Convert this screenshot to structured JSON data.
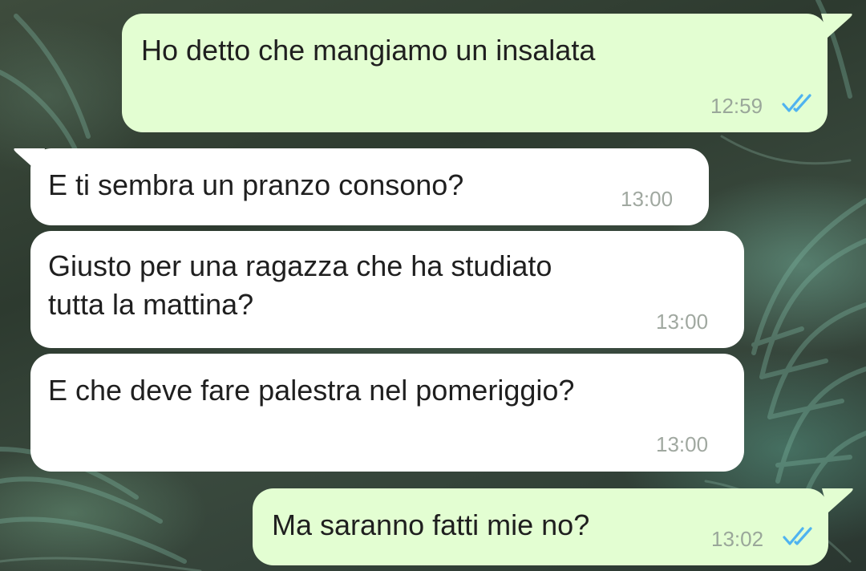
{
  "colors": {
    "outgoing_bubble": "#e3fed2",
    "incoming_bubble": "#ffffff",
    "read_ticks": "#4fb3f0",
    "timestamp": "#a0a8a0"
  },
  "messages": [
    {
      "direction": "outgoing",
      "text": "Ho detto che mangiamo un insalata",
      "time": "12:59",
      "status_icon": "double-check-read-icon"
    },
    {
      "direction": "incoming",
      "text": "E ti sembra un pranzo consono?",
      "time": "13:00"
    },
    {
      "direction": "incoming",
      "text": "Giusto per una ragazza che ha studiato\ntutta la mattina?",
      "time": "13:00"
    },
    {
      "direction": "incoming",
      "text": "E che deve fare palestra nel pomeriggio?",
      "time": "13:00"
    },
    {
      "direction": "outgoing",
      "text": "Ma saranno fatti mie no?",
      "time": "13:02",
      "status_icon": "double-check-read-icon"
    }
  ]
}
